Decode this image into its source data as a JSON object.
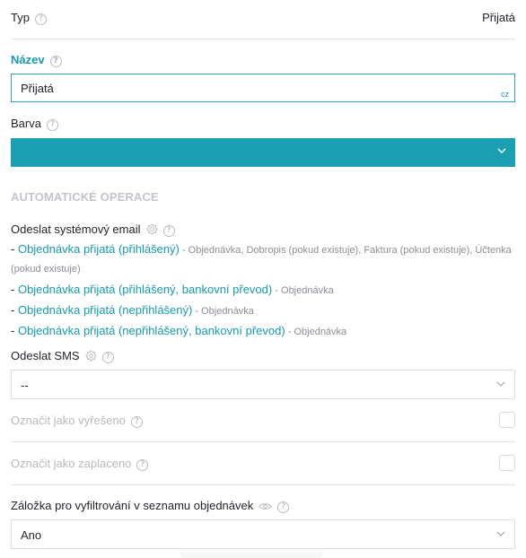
{
  "typ": {
    "label": "Typ",
    "value": "Přijatá"
  },
  "nazev": {
    "label": "Název",
    "value": "Přijatá",
    "lang": "cz"
  },
  "barva": {
    "label": "Barva",
    "color": "#1aa0b1"
  },
  "section": {
    "title": "AUTOMATICKÉ OPERACE"
  },
  "email": {
    "label": "Odeslat systémový email",
    "items": [
      {
        "dash": "- ",
        "link": "Objednávka přijatá (přihlášený)",
        "note": " - Objednávka, Dobropis (pokud existuje), Faktura (pokud existuje), Účtenka (pokud existuje)"
      },
      {
        "dash": "- ",
        "link": "Objednávka přijatá (přihlášený, bankovní převod)",
        "note": " - Objednávka"
      },
      {
        "dash": "- ",
        "link": "Objednávka přijatá (nepřihlášený)",
        "note": " - Objednávka"
      },
      {
        "dash": "- ",
        "link": "Objednávka přijatá (nepřihlášený, bankovní převod)",
        "note": " - Objednávka"
      }
    ]
  },
  "sms": {
    "label": "Odeslat SMS",
    "value": "--"
  },
  "resolved": {
    "label": "Označit jako vyřešeno"
  },
  "paid": {
    "label": "Označit jako zaplaceno"
  },
  "filter_tab": {
    "label": "Záložka pro vyfiltrování v seznamu objednávek",
    "value": "Ano"
  },
  "colors": {
    "accent": "#169bab",
    "select_fill": "#1aa0b1",
    "muted": "#b6b9bd"
  }
}
